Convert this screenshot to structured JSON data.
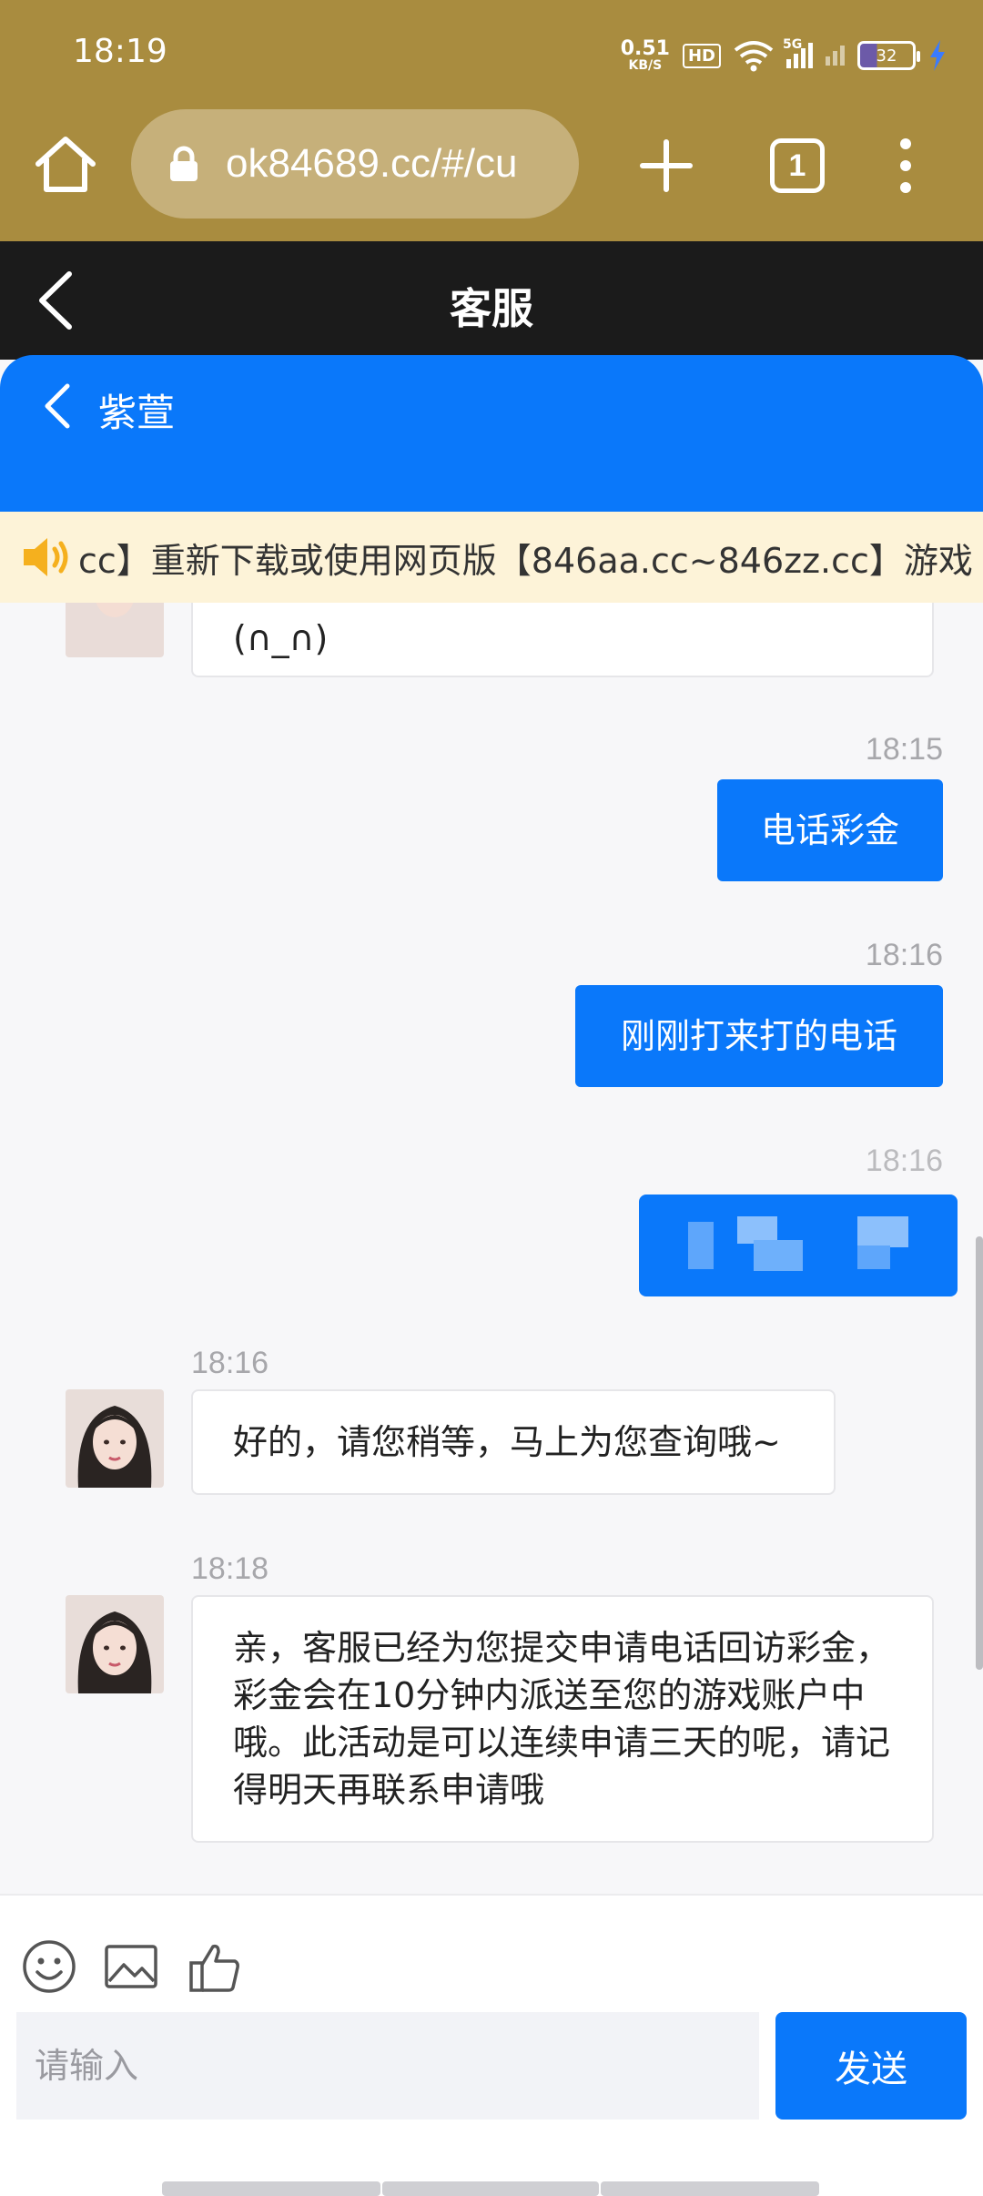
{
  "status_bar": {
    "time": "18:19",
    "net_speed": "0.51",
    "net_unit": "KB/S",
    "hd": "HD",
    "signal_label": "5G",
    "battery": "32"
  },
  "browser": {
    "url": "ok84689.cc/#/cu",
    "tab_count": "1"
  },
  "page": {
    "title": "客服"
  },
  "agent": {
    "name": "紫萱"
  },
  "notice": {
    "text": "cc】重新下载或使用网页版【846aa.cc~846zz.cc】游戏"
  },
  "messages": [
    {
      "side": "in",
      "text": "(∩_∩)"
    },
    {
      "side": "out",
      "time": "18:15",
      "text": "电话彩金"
    },
    {
      "side": "out",
      "time": "18:16",
      "text": "刚刚打来打的电话"
    },
    {
      "side": "out",
      "time": "18:16",
      "text": ""
    },
    {
      "side": "in",
      "time": "18:16",
      "text": "好的，请您稍等，马上为您查询哦~"
    },
    {
      "side": "in",
      "time": "18:18",
      "text": "亲，客服已经为您提交申请电话回访彩金，彩金会在10分钟内派送至您的游戏账户中哦。此活动是可以连续申请三天的呢，请记得明天再联系申请哦"
    }
  ],
  "composer": {
    "placeholder": "请输入",
    "send_label": "发送"
  },
  "colors": {
    "browser_bar": "#a98c3f",
    "accent_blue": "#0a78fa",
    "header_dark": "#1b1b1b",
    "notice_bg": "#fdf3d8"
  }
}
